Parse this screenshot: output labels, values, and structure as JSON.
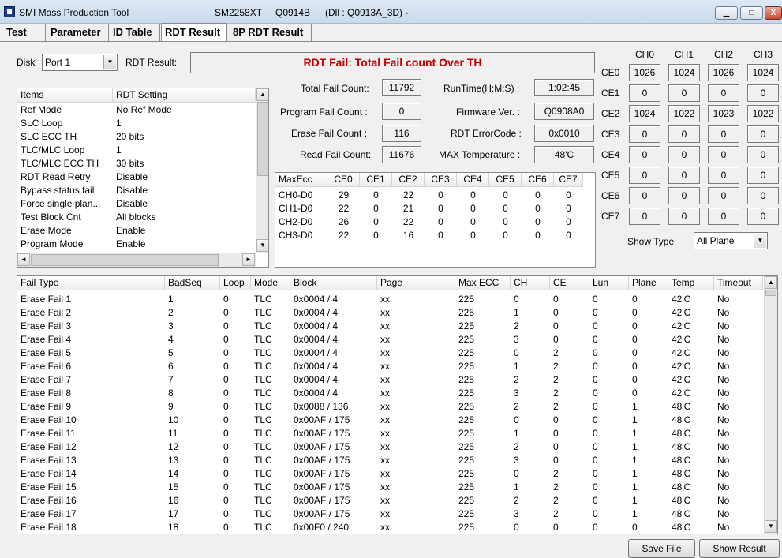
{
  "window": {
    "title_app": "SMI Mass Production Tool",
    "title_chip": "SM2258XT",
    "title_ver": "Q0914B",
    "title_dll": "(Dll : Q0913A_3D) -",
    "btn_min": "▁",
    "btn_max": "□",
    "btn_close": "X"
  },
  "tabs": [
    "Test",
    "Parameter",
    "ID Table",
    "RDT Result",
    "8P RDT Result"
  ],
  "disk": {
    "label": "Disk",
    "value": "Port 1"
  },
  "rdt": {
    "label": "RDT Result:",
    "value": "RDT Fail: Total Fail count Over TH"
  },
  "settings": {
    "headers": [
      "Items",
      "RDT Setting"
    ],
    "rows": [
      [
        "Ref Mode",
        "No Ref Mode"
      ],
      [
        "SLC Loop",
        "1"
      ],
      [
        "SLC ECC TH",
        "20 bits"
      ],
      [
        "TLC/MLC Loop",
        "1"
      ],
      [
        "TLC/MLC ECC TH",
        "30 bits"
      ],
      [
        "RDT Read Retry",
        "Disable"
      ],
      [
        "Bypass status fail",
        "Disable"
      ],
      [
        "Force single plan...",
        "Disable"
      ],
      [
        "Test Block Cnt",
        "All blocks"
      ],
      [
        "Erase Mode",
        "Enable"
      ],
      [
        "Program Mode",
        "Enable"
      ]
    ]
  },
  "counts": {
    "total_label": "Total Fail Count:",
    "total": "11792",
    "program_label": "Program Fail Count :",
    "program": "0",
    "erase_label": "Erase Fail Count :",
    "erase": "116",
    "read_label": "Read Fail Count:",
    "read": "11676",
    "runtime_label": "RunTime(H:M:S) :",
    "runtime": "1:02:45",
    "firmware_label": "Firmware Ver. :",
    "firmware": "Q0908A0",
    "errorcode_label": "RDT ErrorCode :",
    "errorcode": "0x0010",
    "maxtemp_label": "MAX Temperature :",
    "maxtemp": "48'C"
  },
  "maxecc": {
    "headers": [
      "MaxEcc",
      "CE0",
      "CE1",
      "CE2",
      "CE3",
      "CE4",
      "CE5",
      "CE6",
      "CE7"
    ],
    "rows": [
      [
        "CH0-D0",
        "29",
        "0",
        "22",
        "0",
        "0",
        "0",
        "0",
        "0"
      ],
      [
        "CH1-D0",
        "22",
        "0",
        "21",
        "0",
        "0",
        "0",
        "0",
        "0"
      ],
      [
        "CH2-D0",
        "26",
        "0",
        "22",
        "0",
        "0",
        "0",
        "0",
        "0"
      ],
      [
        "CH3-D0",
        "22",
        "0",
        "16",
        "0",
        "0",
        "0",
        "0",
        "0"
      ]
    ]
  },
  "channels": {
    "headers": [
      "CH0",
      "CH1",
      "CH2",
      "CH3"
    ],
    "rows": [
      {
        "label": "CE0",
        "values": [
          "1026",
          "1024",
          "1026",
          "1024"
        ]
      },
      {
        "label": "CE1",
        "values": [
          "0",
          "0",
          "0",
          "0"
        ]
      },
      {
        "label": "CE2",
        "values": [
          "1024",
          "1022",
          "1023",
          "1022"
        ]
      },
      {
        "label": "CE3",
        "values": [
          "0",
          "0",
          "0",
          "0"
        ]
      },
      {
        "label": "CE4",
        "values": [
          "0",
          "0",
          "0",
          "0"
        ]
      },
      {
        "label": "CE5",
        "values": [
          "0",
          "0",
          "0",
          "0"
        ]
      },
      {
        "label": "CE6",
        "values": [
          "0",
          "0",
          "0",
          "0"
        ]
      },
      {
        "label": "CE7",
        "values": [
          "0",
          "0",
          "0",
          "0"
        ]
      }
    ],
    "show_type_label": "Show Type",
    "show_type_value": "All Plane"
  },
  "fails": {
    "headers": [
      "Fail Type",
      "BadSeq",
      "Loop",
      "Mode",
      "Block",
      "Page",
      "Max ECC",
      "CH",
      "CE",
      "Lun",
      "Plane",
      "Temp",
      "Timeout"
    ],
    "rows": [
      [
        "Erase Fail  1",
        "1",
        "0",
        "TLC",
        "0x0004 / 4",
        "xx",
        "225",
        "0",
        "0",
        "0",
        "0",
        "42'C",
        "No"
      ],
      [
        "Erase Fail  2",
        "2",
        "0",
        "TLC",
        "0x0004 / 4",
        "xx",
        "225",
        "1",
        "0",
        "0",
        "0",
        "42'C",
        "No"
      ],
      [
        "Erase Fail  3",
        "3",
        "0",
        "TLC",
        "0x0004 / 4",
        "xx",
        "225",
        "2",
        "0",
        "0",
        "0",
        "42'C",
        "No"
      ],
      [
        "Erase Fail  4",
        "4",
        "0",
        "TLC",
        "0x0004 / 4",
        "xx",
        "225",
        "3",
        "0",
        "0",
        "0",
        "42'C",
        "No"
      ],
      [
        "Erase Fail  5",
        "5",
        "0",
        "TLC",
        "0x0004 / 4",
        "xx",
        "225",
        "0",
        "2",
        "0",
        "0",
        "42'C",
        "No"
      ],
      [
        "Erase Fail  6",
        "6",
        "0",
        "TLC",
        "0x0004 / 4",
        "xx",
        "225",
        "1",
        "2",
        "0",
        "0",
        "42'C",
        "No"
      ],
      [
        "Erase Fail  7",
        "7",
        "0",
        "TLC",
        "0x0004 / 4",
        "xx",
        "225",
        "2",
        "2",
        "0",
        "0",
        "42'C",
        "No"
      ],
      [
        "Erase Fail  8",
        "8",
        "0",
        "TLC",
        "0x0004 / 4",
        "xx",
        "225",
        "3",
        "2",
        "0",
        "0",
        "42'C",
        "No"
      ],
      [
        "Erase Fail  9",
        "9",
        "0",
        "TLC",
        "0x0088 / 136",
        "xx",
        "225",
        "2",
        "2",
        "0",
        "1",
        "48'C",
        "No"
      ],
      [
        "Erase Fail  10",
        "10",
        "0",
        "TLC",
        "0x00AF / 175",
        "xx",
        "225",
        "0",
        "0",
        "0",
        "1",
        "48'C",
        "No"
      ],
      [
        "Erase Fail  11",
        "11",
        "0",
        "TLC",
        "0x00AF / 175",
        "xx",
        "225",
        "1",
        "0",
        "0",
        "1",
        "48'C",
        "No"
      ],
      [
        "Erase Fail  12",
        "12",
        "0",
        "TLC",
        "0x00AF / 175",
        "xx",
        "225",
        "2",
        "0",
        "0",
        "1",
        "48'C",
        "No"
      ],
      [
        "Erase Fail  13",
        "13",
        "0",
        "TLC",
        "0x00AF / 175",
        "xx",
        "225",
        "3",
        "0",
        "0",
        "1",
        "48'C",
        "No"
      ],
      [
        "Erase Fail  14",
        "14",
        "0",
        "TLC",
        "0x00AF / 175",
        "xx",
        "225",
        "0",
        "2",
        "0",
        "1",
        "48'C",
        "No"
      ],
      [
        "Erase Fail  15",
        "15",
        "0",
        "TLC",
        "0x00AF / 175",
        "xx",
        "225",
        "1",
        "2",
        "0",
        "1",
        "48'C",
        "No"
      ],
      [
        "Erase Fail  16",
        "16",
        "0",
        "TLC",
        "0x00AF / 175",
        "xx",
        "225",
        "2",
        "2",
        "0",
        "1",
        "48'C",
        "No"
      ],
      [
        "Erase Fail  17",
        "17",
        "0",
        "TLC",
        "0x00AF / 175",
        "xx",
        "225",
        "3",
        "2",
        "0",
        "1",
        "48'C",
        "No"
      ],
      [
        "Erase Fail  18",
        "18",
        "0",
        "TLC",
        "0x00F0 / 240",
        "xx",
        "225",
        "0",
        "0",
        "0",
        "0",
        "48'C",
        "No"
      ]
    ]
  },
  "buttons": {
    "save": "Save File",
    "show": "Show Result"
  },
  "icons": {
    "up": "scroll-up-icon",
    "down": "scroll-down-icon",
    "left": "scroll-left-icon",
    "right": "scroll-right-icon"
  }
}
